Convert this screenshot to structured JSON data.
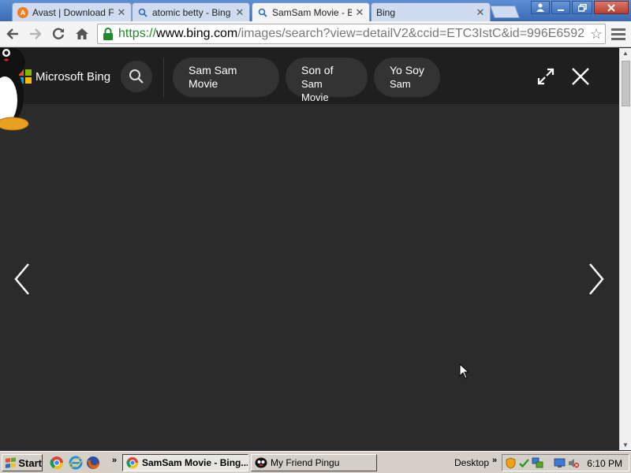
{
  "browser": {
    "tabs": [
      {
        "title": "Avast | Download Fr",
        "icon": "avast-icon",
        "active": false
      },
      {
        "title": "atomic betty - Bing",
        "icon": "search-icon",
        "active": false
      },
      {
        "title": "SamSam Movie - Bing",
        "icon": "search-icon",
        "active": true
      },
      {
        "title": "Bing",
        "icon": "none",
        "active": false
      }
    ],
    "url": {
      "scheme": "https://",
      "host": "www.bing.com",
      "path": "/images/search?view=detailV2&ccid=ETC3IstC&id=996E6592"
    }
  },
  "bing": {
    "logo_text": "Microsoft Bing",
    "logo_colors": [
      "#f25022",
      "#7fba00",
      "#00a4ef",
      "#ffb900"
    ],
    "related_searches": [
      {
        "line1": "Sam Sam Movie",
        "line2": ""
      },
      {
        "line1": "Son of",
        "line2": "Sam Movie"
      },
      {
        "line1": "Yo Soy",
        "line2": "Sam"
      }
    ]
  },
  "taskbar": {
    "start_label": "Start",
    "tasks": [
      {
        "label": "SamSam Movie - Bing...",
        "active": true
      },
      {
        "label": "My Friend Pingu",
        "active": false
      }
    ],
    "desktop_label": "Desktop",
    "clock": "6:10 PM"
  }
}
